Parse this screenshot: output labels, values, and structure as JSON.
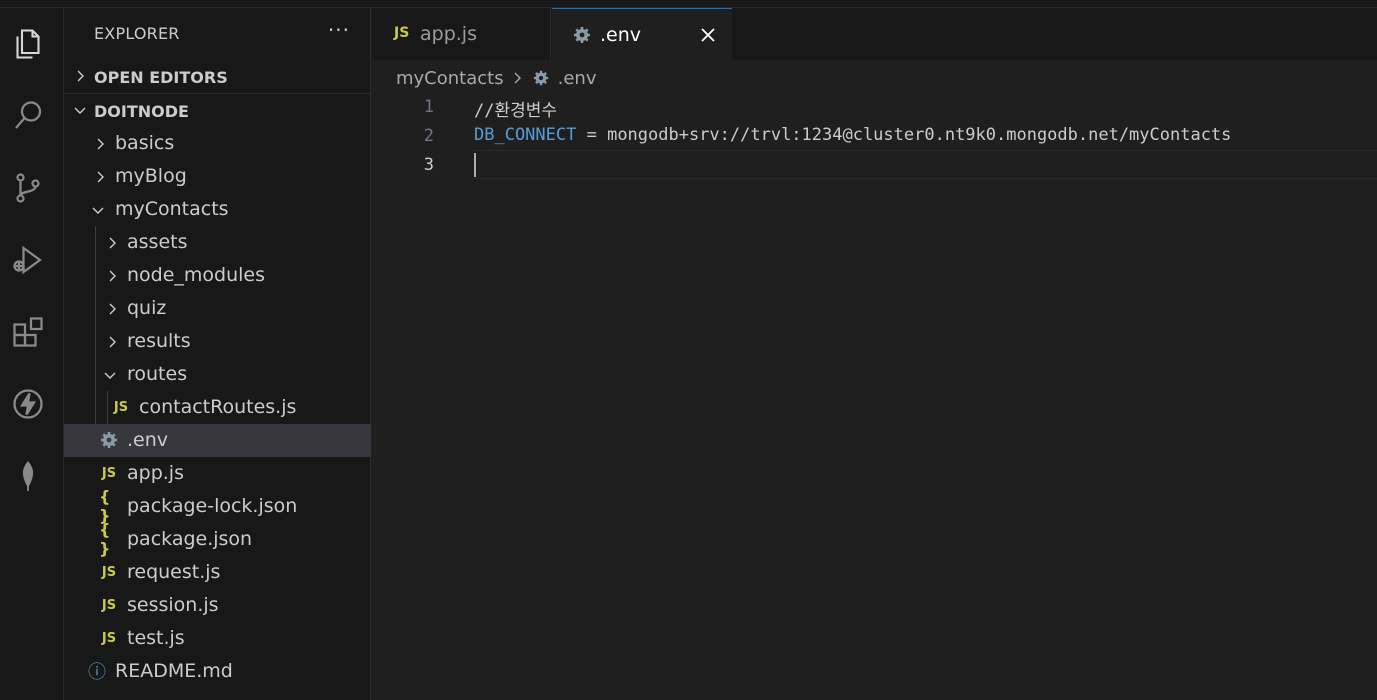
{
  "sidebar": {
    "title": "EXPLORER",
    "more": "···",
    "open_editors": "OPEN EDITORS",
    "workspace": "DOITNODE",
    "items": [
      {
        "label": "basics"
      },
      {
        "label": "myBlog"
      },
      {
        "label": "myContacts"
      },
      {
        "label": "assets"
      },
      {
        "label": "node_modules"
      },
      {
        "label": "quiz"
      },
      {
        "label": "results"
      },
      {
        "label": "routes"
      },
      {
        "label": "contactRoutes.js",
        "icon": "JS"
      },
      {
        "label": ".env"
      },
      {
        "label": "app.js",
        "icon": "JS"
      },
      {
        "label": "package-lock.json",
        "icon": "{ }"
      },
      {
        "label": "package.json",
        "icon": "{ }"
      },
      {
        "label": "request.js",
        "icon": "JS"
      },
      {
        "label": "session.js",
        "icon": "JS"
      },
      {
        "label": "test.js",
        "icon": "JS"
      },
      {
        "label": "README.md",
        "icon": "ⓘ"
      }
    ]
  },
  "tabs": [
    {
      "label": "app.js",
      "icon": "JS"
    },
    {
      "label": ".env"
    }
  ],
  "breadcrumb": {
    "folder": "myContacts",
    "file": ".env"
  },
  "editor": {
    "lines": [
      {
        "number": "1",
        "comment": "//환경변수"
      },
      {
        "number": "2",
        "key": "DB_CONNECT",
        "op": " = ",
        "value": "mongodb+srv://trvl:1234@cluster0.nt9k0.mongodb.net/myContacts"
      },
      {
        "number": "3"
      }
    ]
  },
  "colors": {
    "accent": "#0078d4",
    "js_icon": "#cbcb41",
    "env_key": "#569cd6",
    "selected_row": "#37373d"
  }
}
